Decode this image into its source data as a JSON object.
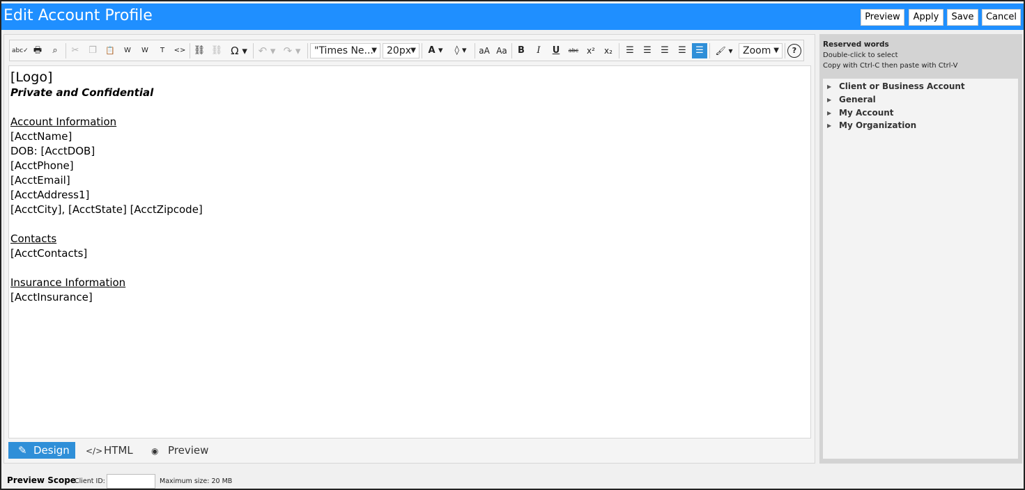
{
  "window": {
    "title": "Edit Account Profile"
  },
  "header_buttons": {
    "preview": "Preview",
    "apply": "Apply",
    "save": "Save",
    "cancel": "Cancel"
  },
  "toolbar": {
    "spellcheck": "abc✓",
    "print": "🖶",
    "find": "⌕",
    "cut": "✂",
    "copy": "❐",
    "paste": "📋",
    "paste_word": "W",
    "paste_word2": "W",
    "paste_text": "T",
    "paste_html": "<>",
    "link": "⛓",
    "unlink": "⛓",
    "special_char": "Ω ▾",
    "undo": "↶ ▾",
    "redo": "↷ ▾",
    "font_family": "\"Times Ne...",
    "font_size": "20px",
    "font_color": "A ▾",
    "highlight": "◊ ▾",
    "lowercase": "aA",
    "titlecase": "Aa",
    "bold": "B",
    "italic": "I",
    "underline": "U",
    "strike": "abc",
    "superscript": "x²",
    "subscript": "x₂",
    "align_left": "☰",
    "align_center": "☰",
    "align_right": "☰",
    "align_justify": "☰",
    "align_none": "☰",
    "format_painter": "🖌 ▾",
    "zoom": "Zoom",
    "help": "?"
  },
  "document": {
    "logo": "[Logo]",
    "confidential": "Private and Confidential",
    "account_heading": "Account Information",
    "account_lines": [
      "[AcctName]",
      "DOB: [AcctDOB]",
      "[AcctPhone]",
      "[AcctEmail]",
      "[AcctAddress1]",
      "[AcctCity], [AcctState] [AcctZipcode]"
    ],
    "contacts_heading": "Contacts",
    "contacts_line": "[AcctContacts]",
    "insurance_heading": "Insurance Information",
    "insurance_line": "[AcctInsurance]"
  },
  "modes": {
    "design": "Design",
    "html": "HTML",
    "preview": "Preview"
  },
  "icons": {
    "design": "pencil-icon",
    "html": "code-icon",
    "preview": "eye-icon"
  },
  "reserved": {
    "title": "Reserved words",
    "hint1": "Double-click to select",
    "hint2": "Copy with Ctrl-C then paste with Ctrl-V",
    "items": [
      "Client or Business Account",
      "General",
      "My Account",
      "My Organization"
    ]
  },
  "footer": {
    "scope": "Preview Scope",
    "client_id_label": "Client ID:",
    "client_id_value": "",
    "max_size": "Maximum size: 20 MB"
  },
  "colors": {
    "title_bar": "#1f8fff",
    "active": "#2f8fd8"
  }
}
